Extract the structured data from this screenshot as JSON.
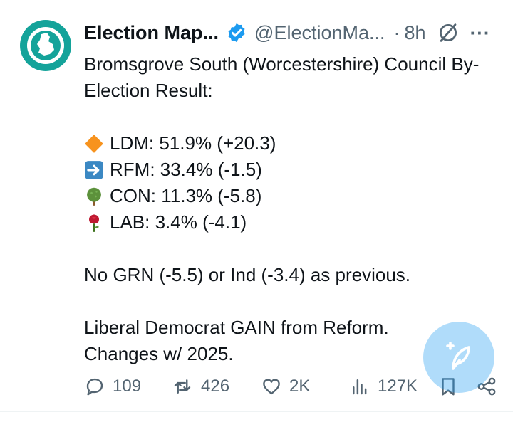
{
  "author": {
    "name": "Election Map...",
    "handle": "@ElectionMa...",
    "separator": "·",
    "time": "8h",
    "avatar_icon": "map-logo-icon",
    "verified_icon": "verified-badge-icon",
    "grok_icon": "grok-icon",
    "more_icon": "more-dots-icon",
    "more_label": "···"
  },
  "post": {
    "title_line1": "Bromsgrove South (Worcestershire) Council By-",
    "title_line2": "Election Result:",
    "results": [
      {
        "icon": "orange-diamond-icon",
        "text": "LDM: 51.9% (+20.3)"
      },
      {
        "icon": "right-arrow-icon",
        "text": "RFM: 33.4% (-1.5)"
      },
      {
        "icon": "deciduous-tree-icon",
        "text": "CON: 11.3% (-5.8)"
      },
      {
        "icon": "rose-icon",
        "text": "LAB: 3.4% (-4.1)"
      }
    ],
    "note": "No GRN (-5.5) or Ind (-3.4) as previous.",
    "gain_line1": "Liberal Democrat GAIN from Reform.",
    "gain_line2": "Changes w/ 2025."
  },
  "actions": {
    "replies": {
      "icon": "reply-icon",
      "count": "109"
    },
    "reposts": {
      "icon": "repost-icon",
      "count": "426"
    },
    "likes": {
      "icon": "heart-icon",
      "count": "2K"
    },
    "views": {
      "icon": "views-icon",
      "count": "127K"
    },
    "bookmark": {
      "icon": "bookmark-icon"
    },
    "share": {
      "icon": "share-icon"
    }
  },
  "compose": {
    "icon": "compose-feather-icon"
  },
  "colors": {
    "accent": "#1d9bf0",
    "avatar_bg": "#14a39a",
    "text": "#0f1419",
    "secondary": "#536471"
  }
}
